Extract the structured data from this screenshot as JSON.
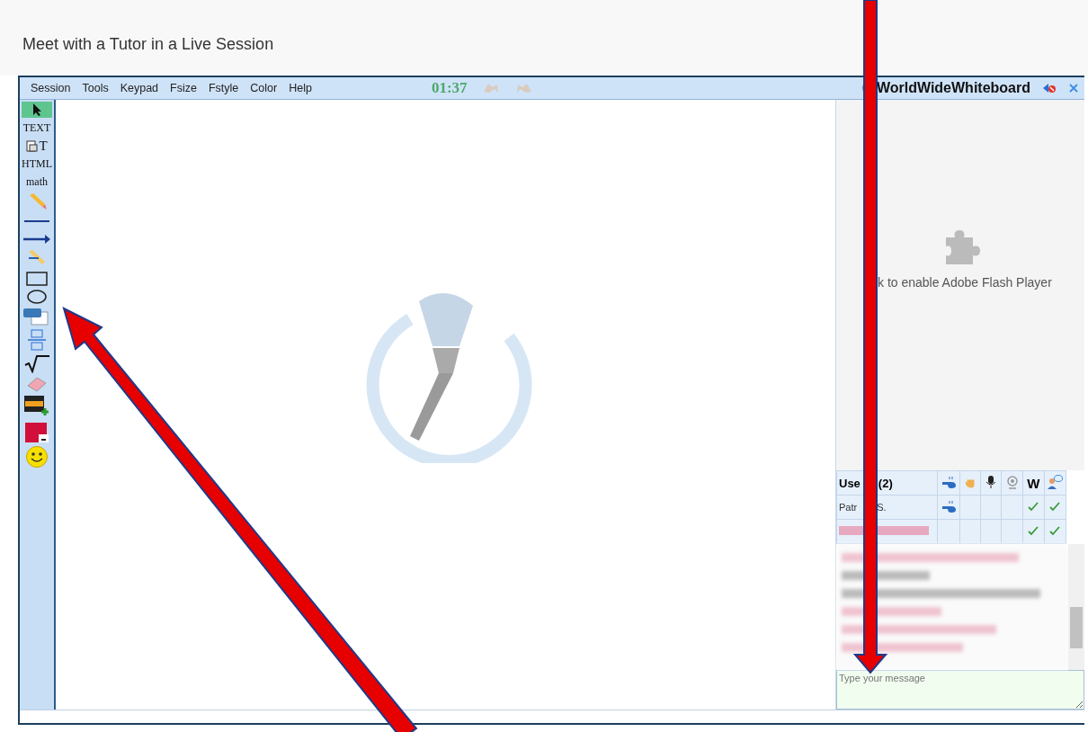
{
  "page_title": "Meet with a Tutor in a Live Session",
  "menu": [
    "Session",
    "Tools",
    "Keypad",
    "Fsize",
    "Fstyle",
    "Color",
    "Help"
  ],
  "timer": "01:37",
  "brand": "WorldWideWhiteboard",
  "tools": [
    {
      "kind": "pointer",
      "selected": true
    },
    {
      "kind": "label",
      "label": "TEXT",
      "selected": false
    },
    {
      "kind": "paste-text",
      "label": "T",
      "selected": false
    },
    {
      "kind": "label",
      "label": "HTML",
      "selected": false
    },
    {
      "kind": "label",
      "label": "math",
      "selected": false
    },
    {
      "kind": "pencil",
      "selected": false
    },
    {
      "kind": "line",
      "selected": false
    },
    {
      "kind": "arrow",
      "selected": false
    },
    {
      "kind": "highlighter",
      "selected": false
    },
    {
      "kind": "rectangle",
      "selected": false
    },
    {
      "kind": "ellipse",
      "selected": false
    },
    {
      "kind": "url",
      "selected": false
    },
    {
      "kind": "fraction",
      "selected": false
    },
    {
      "kind": "sqrt",
      "selected": false
    },
    {
      "kind": "eraser",
      "selected": false
    },
    {
      "kind": "image",
      "selected": false
    },
    {
      "kind": "color",
      "selected": false
    },
    {
      "kind": "smiley",
      "selected": false
    }
  ],
  "flash_text": "k to enable Adobe Flash Player",
  "users": {
    "heading_start": "Use",
    "heading_end": "(2)",
    "columns": [
      {
        "kind": "whistle"
      },
      {
        "kind": "hand"
      },
      {
        "kind": "mic"
      },
      {
        "kind": "webcam"
      },
      {
        "kind": "w",
        "label": "W"
      },
      {
        "kind": "chat"
      }
    ],
    "rows": [
      {
        "name_start": "Patr",
        "name_end": "S.",
        "redacted": false,
        "cells": [
          true,
          false,
          false,
          false,
          true,
          true
        ]
      },
      {
        "redacted": true,
        "cells": [
          false,
          false,
          false,
          false,
          true,
          true
        ]
      }
    ]
  },
  "chat_input": {
    "placeholder": "Type your message"
  }
}
